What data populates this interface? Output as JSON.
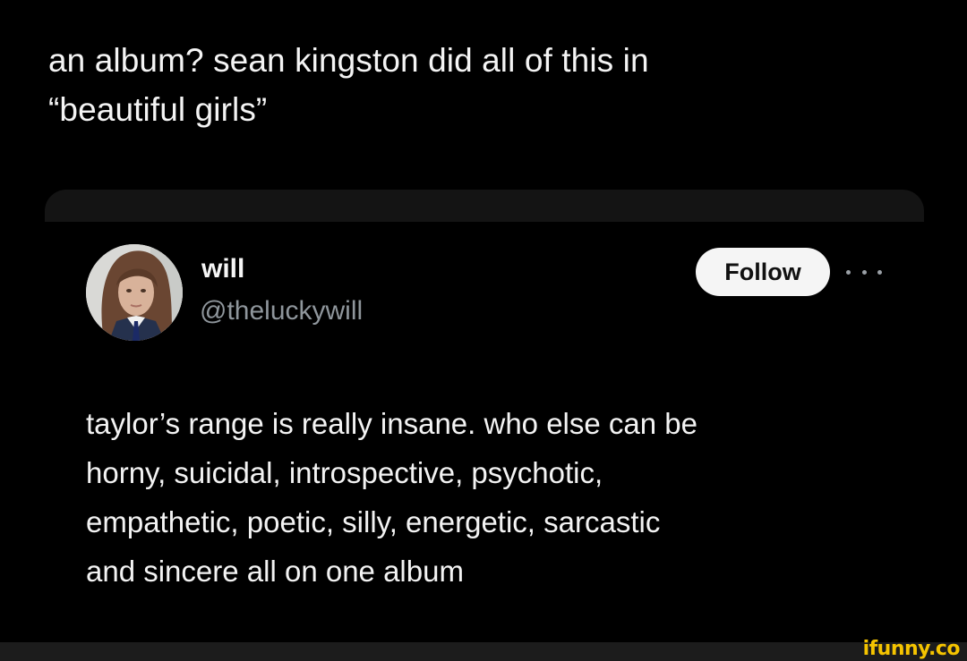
{
  "post": {
    "caption_line1": "an album? sean kingston did all of this in",
    "caption_line2": "“beautiful girls”"
  },
  "tweet": {
    "display_name": "will",
    "handle": "@theluckywill",
    "follow_label": "Follow",
    "more_icon": "more-horizontal-icon",
    "text_lines": [
      "taylor’s range is really insane. who else can be",
      "horny, suicidal, introspective, psychotic,",
      "empathetic, poetic, silly, energetic, sarcastic",
      "and sincere all on one album"
    ]
  },
  "watermark": {
    "text": "ifunny.co",
    "color": "#f5c400"
  }
}
